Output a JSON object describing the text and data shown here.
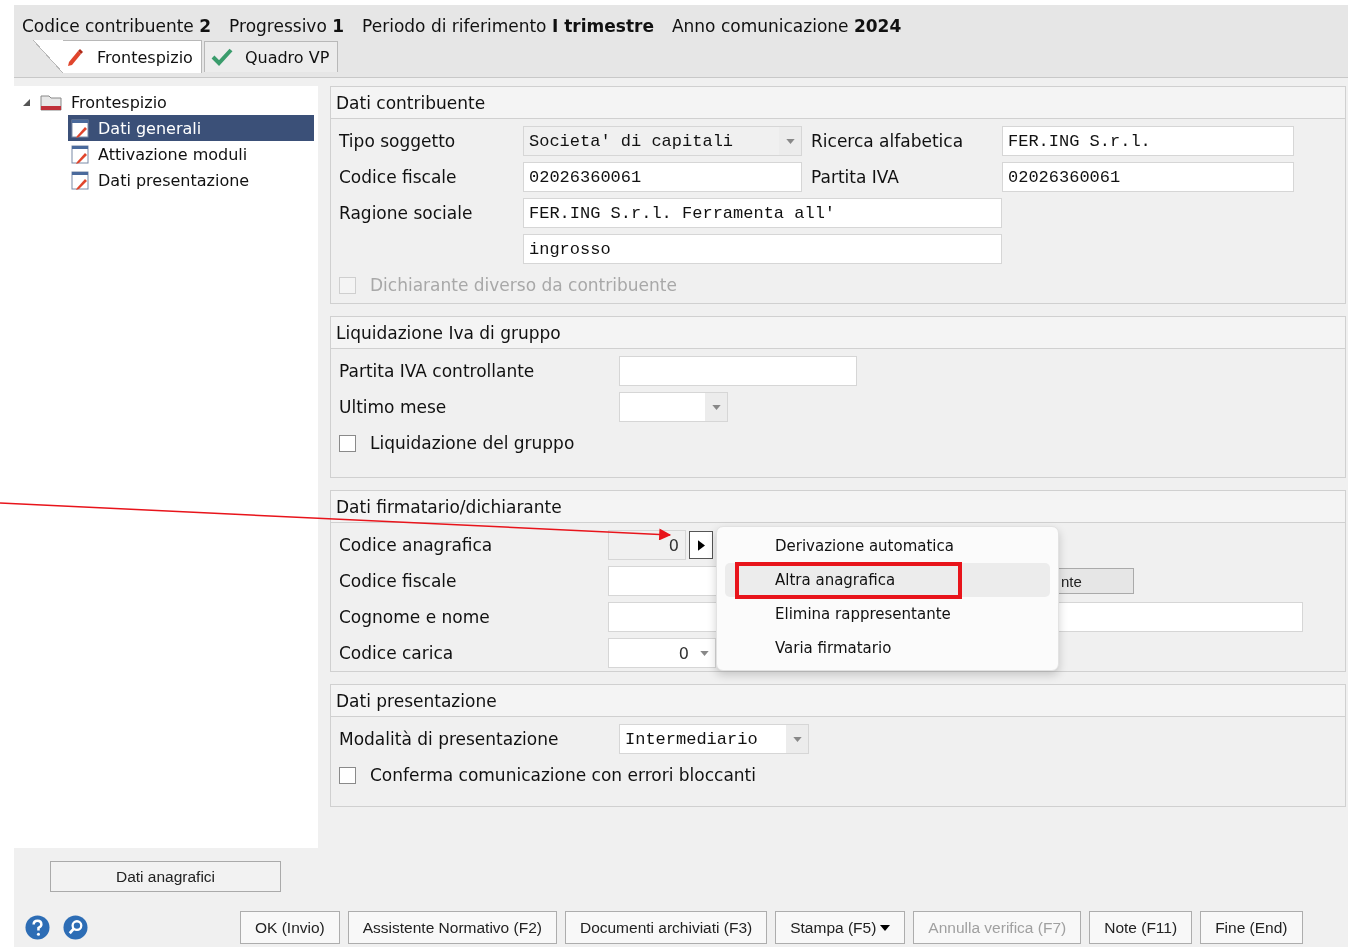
{
  "header": {
    "items": [
      {
        "label": "Codice contribuente",
        "value": "2"
      },
      {
        "label": "Progressivo",
        "value": "1"
      },
      {
        "label": "Periodo di riferimento",
        "value": "I trimestre"
      },
      {
        "label": "Anno comunicazione",
        "value": "2024"
      }
    ]
  },
  "tabs": [
    {
      "label": "Frontespizio",
      "kind": "pencil",
      "selected": true
    },
    {
      "label": "Quadro VP",
      "kind": "check",
      "selected": false
    }
  ],
  "tree": {
    "label": "Frontespizio",
    "expanded": true,
    "children": [
      {
        "label": "Dati generali",
        "selected": true
      },
      {
        "label": "Attivazione moduli",
        "selected": false
      },
      {
        "label": "Dati presentazione",
        "selected": false
      }
    ]
  },
  "sections": [
    {
      "title": "Dati contribuente",
      "rows": [
        [
          {
            "kind": "label",
            "text": "Tipo soggetto"
          },
          {
            "kind": "combo",
            "value": "Societa' di capitali",
            "readonly": true
          },
          {
            "kind": "label",
            "text": "Ricerca alfabetica"
          },
          {
            "kind": "text",
            "value": "FER.ING S.r.l."
          }
        ],
        [
          {
            "kind": "label",
            "text": "Codice fiscale"
          },
          {
            "kind": "text",
            "value": "02026360061"
          },
          {
            "kind": "label",
            "text": "Partita IVA"
          },
          {
            "kind": "text",
            "value": "02026360061"
          }
        ],
        [
          {
            "kind": "label",
            "text": "Ragione sociale"
          },
          {
            "kind": "text",
            "value": "FER.ING S.r.l. Ferramenta all'"
          }
        ],
        [
          {
            "kind": "text",
            "value": "ingrosso"
          }
        ],
        [
          {
            "kind": "checkbox",
            "label": "Dichiarante diverso da contribuente",
            "checked": false,
            "disabled": true
          }
        ]
      ]
    },
    {
      "title": "Liquidazione Iva di gruppo",
      "rows": [
        [
          {
            "kind": "label",
            "text": "Partita IVA controllante"
          },
          {
            "kind": "text"
          }
        ],
        [
          {
            "kind": "label",
            "text": "Ultimo mese"
          },
          {
            "kind": "combo",
            "readonly": false
          }
        ],
        [
          {
            "kind": "checkbox",
            "label": "Liquidazione del gruppo",
            "checked": false,
            "disabled": false
          }
        ]
      ]
    },
    {
      "title": "Dati firmatario/dichiarante",
      "rows": [
        [
          {
            "kind": "label",
            "text": "Codice anagrafica"
          },
          {
            "kind": "number",
            "value": "0",
            "readonly": true
          },
          {
            "kind": "menu-button",
            "expanded": true
          }
        ],
        [
          {
            "kind": "label",
            "text": "Codice fiscale"
          },
          {
            "kind": "text"
          },
          {
            "kind": "button",
            "label": "nte"
          }
        ],
        [
          {
            "kind": "label",
            "text": "Cognome e nome"
          },
          {
            "kind": "text"
          }
        ],
        [
          {
            "kind": "label",
            "text": "Codice carica"
          },
          {
            "kind": "number-combo",
            "value": "0",
            "readonly": false
          }
        ]
      ]
    },
    {
      "title": "Dati presentazione",
      "rows": [
        [
          {
            "kind": "label",
            "text": "Modalità di presentazione"
          },
          {
            "kind": "combo",
            "value": "Intermediario",
            "readonly": false
          }
        ],
        [
          {
            "kind": "checkbox",
            "label": "Conferma comunicazione con errori bloccanti",
            "checked": false,
            "disabled": false
          }
        ]
      ]
    }
  ],
  "menu": {
    "items": [
      {
        "label": "Derivazione automatica",
        "highlighted": false
      },
      {
        "label": "Altra anagrafica",
        "highlighted": true
      },
      {
        "label": "Elimina rappresentante",
        "highlighted": false
      },
      {
        "label": "Varia firmatario",
        "highlighted": false
      }
    ]
  },
  "side_button": "Dati anagrafici",
  "footer": {
    "buttons": [
      {
        "label": "OK (Invio)",
        "kind": "plain",
        "disabled": false
      },
      {
        "label": "Assistente Normativo (F2)",
        "kind": "plain",
        "disabled": false
      },
      {
        "label": "Documenti archiviati (F3)",
        "kind": "plain",
        "disabled": false
      },
      {
        "label": "Stampa (F5)",
        "kind": "dropdown",
        "disabled": false
      },
      {
        "label": "Annulla verifica (F7)",
        "kind": "plain",
        "disabled": true
      },
      {
        "label": "Note (F11)",
        "kind": "plain",
        "disabled": false
      },
      {
        "label": "Fine (End)",
        "kind": "plain",
        "disabled": false
      }
    ]
  }
}
